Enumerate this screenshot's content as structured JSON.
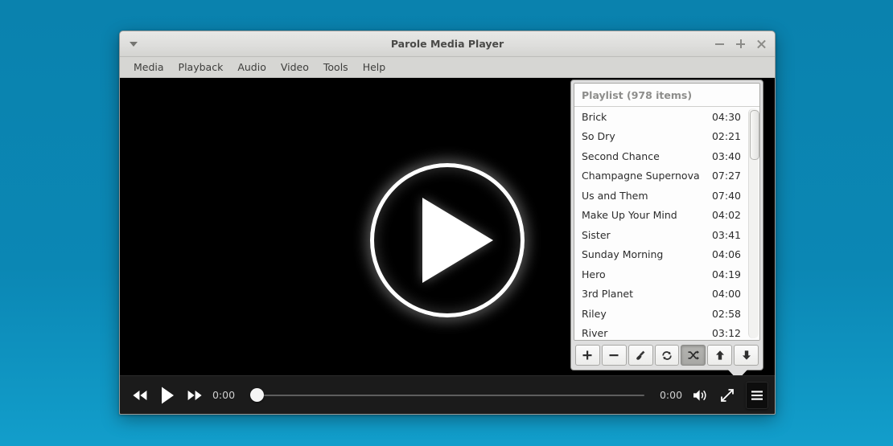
{
  "window": {
    "title": "Parole Media Player",
    "menu_arrow_icon": "caret-down-icon",
    "buttons": {
      "minimize": "−",
      "maximize": "+",
      "close": "×"
    }
  },
  "menubar": {
    "items": [
      {
        "label": "Media"
      },
      {
        "label": "Playback"
      },
      {
        "label": "Audio"
      },
      {
        "label": "Video"
      },
      {
        "label": "Tools"
      },
      {
        "label": "Help"
      }
    ]
  },
  "video": {
    "play_overlay_icon": "play-icon"
  },
  "playlist": {
    "header": "Playlist (978 items)",
    "rows": [
      {
        "title": "Brick",
        "time": "04:30"
      },
      {
        "title": "So Dry",
        "time": "02:21"
      },
      {
        "title": "Second Chance",
        "time": "03:40"
      },
      {
        "title": "Champagne Supernova",
        "time": "07:27"
      },
      {
        "title": "Us and Them",
        "time": "07:40"
      },
      {
        "title": "Make Up Your Mind",
        "time": "04:02"
      },
      {
        "title": "Sister",
        "time": "03:41"
      },
      {
        "title": "Sunday Morning",
        "time": "04:06"
      },
      {
        "title": "Hero",
        "time": "04:19"
      },
      {
        "title": "3rd Planet",
        "time": "04:00"
      },
      {
        "title": "Riley",
        "time": "02:58"
      },
      {
        "title": "River",
        "time": "03:12"
      }
    ],
    "toolbar": [
      {
        "name": "add",
        "icon": "plus-icon",
        "active": false
      },
      {
        "name": "remove",
        "icon": "minus-icon",
        "active": false
      },
      {
        "name": "clear",
        "icon": "broom-icon",
        "active": false
      },
      {
        "name": "repeat",
        "icon": "repeat-icon",
        "active": false
      },
      {
        "name": "shuffle",
        "icon": "shuffle-icon",
        "active": true
      },
      {
        "name": "move-up",
        "icon": "arrow-up-icon",
        "active": false
      },
      {
        "name": "move-down",
        "icon": "arrow-down-icon",
        "active": false
      }
    ]
  },
  "controls": {
    "previous_icon": "rewind-icon",
    "play_icon": "play-icon",
    "next_icon": "forward-icon",
    "elapsed_time": "0:00",
    "total_time": "0:00",
    "seek_position_percent": 0,
    "volume_icon": "volume-icon",
    "fullscreen_icon": "fullscreen-icon",
    "playlist_toggle_icon": "hamburger-icon"
  }
}
